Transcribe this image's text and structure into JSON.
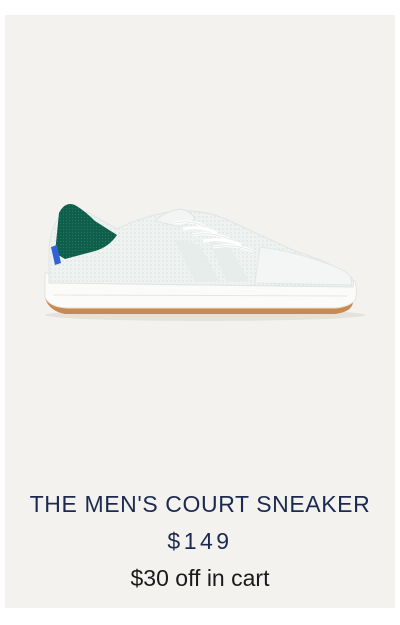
{
  "product": {
    "name": "THE MEN'S COURT SNEAKER",
    "price": "$149",
    "promo": "$30 off in cart"
  },
  "colors": {
    "card_background": "#f3f2ef",
    "name_text": "#1b2a4e",
    "heel_tab": "#0f5e4a",
    "heel_accent": "#2f63d6",
    "outsole": "#c98a52"
  }
}
